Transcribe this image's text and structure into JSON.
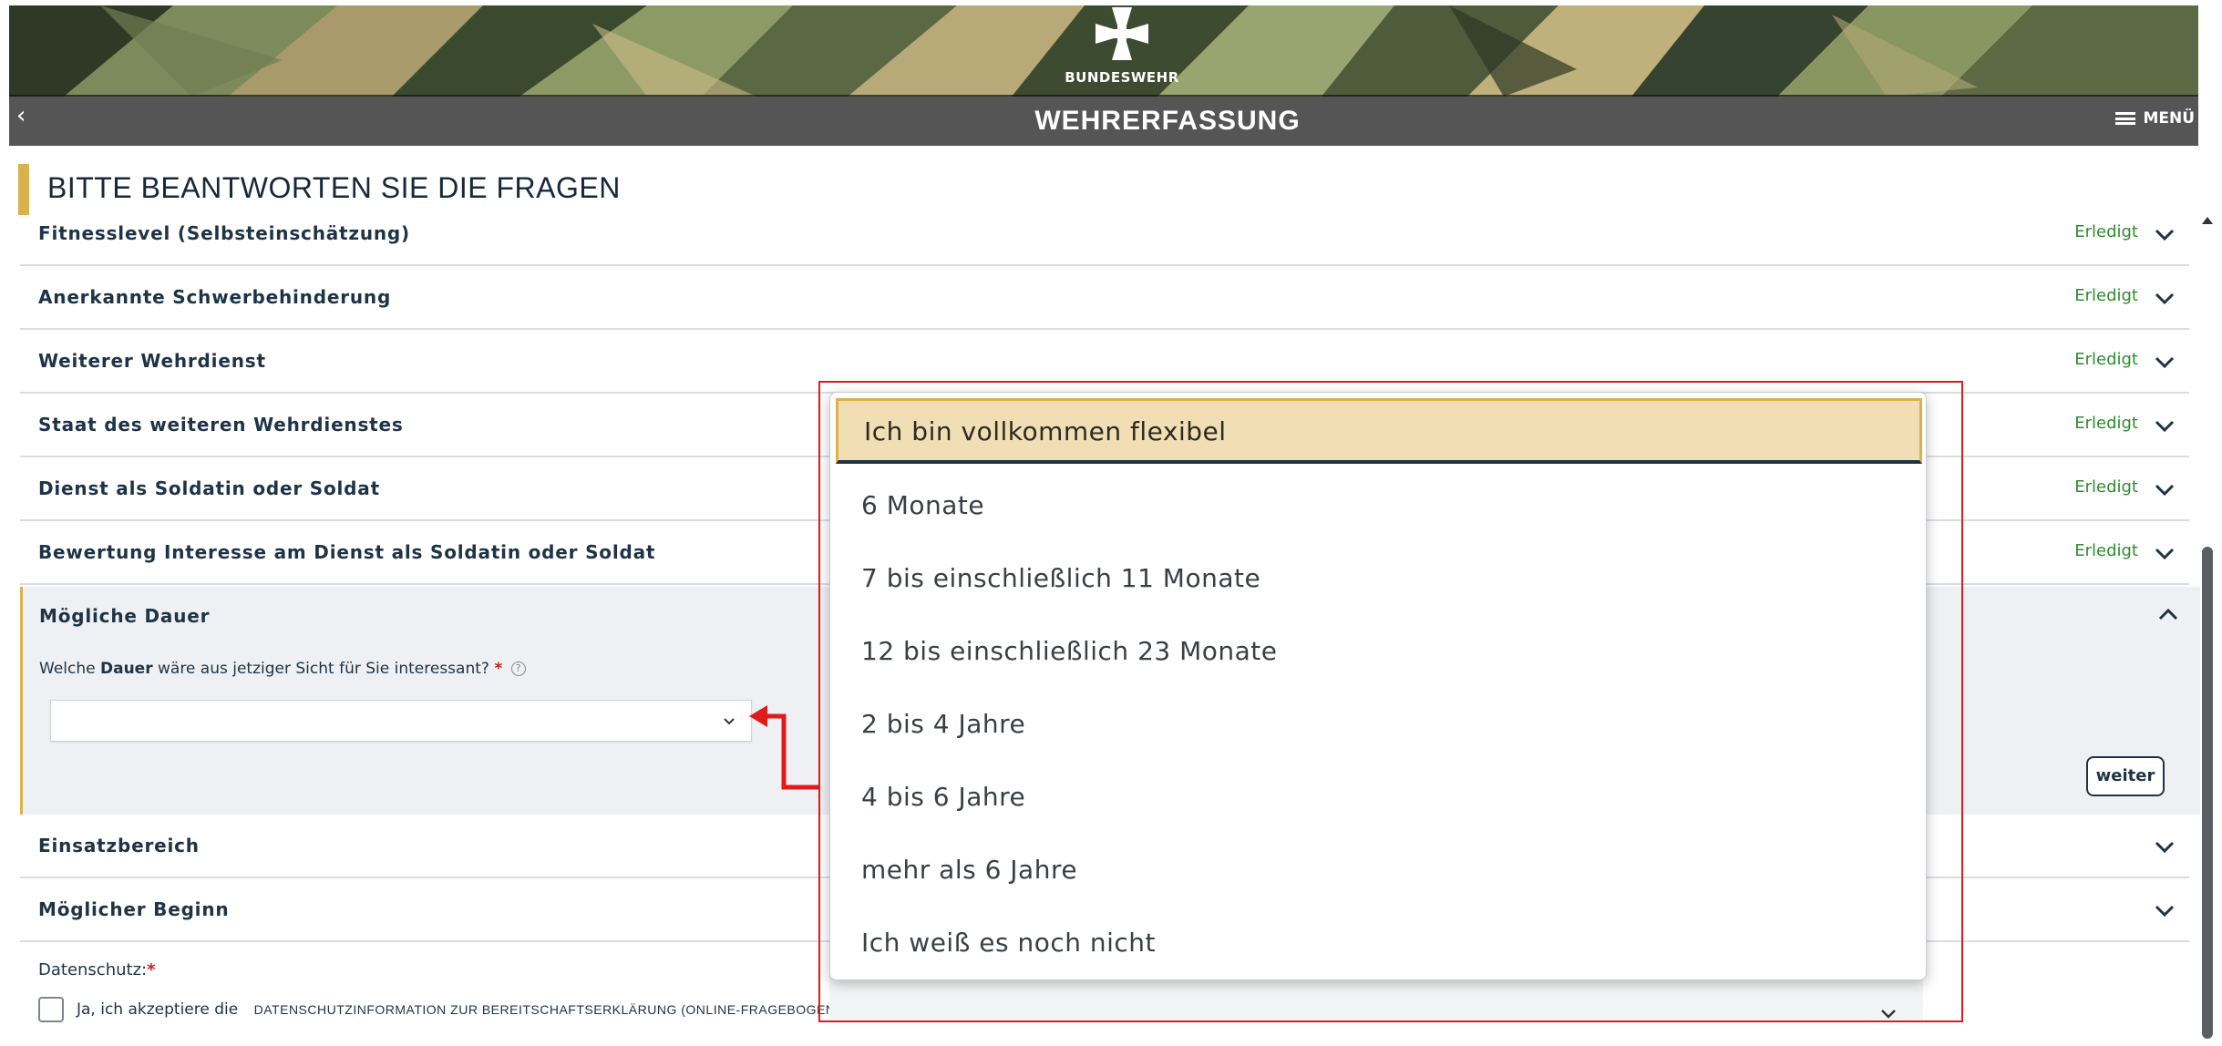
{
  "header": {
    "brand": "BUNDESWEHR",
    "title": "WEHRERFASSUNG",
    "back_icon": "chevron-left-icon",
    "menu_label": "MENÜ",
    "menu_icon": "hamburger-icon"
  },
  "page_heading": "BITTE BEANTWORTEN SIE DIE FRAGEN",
  "sections": [
    {
      "label": "Fitnesslevel (Selbsteinschätzung)",
      "status": "Erledigt"
    },
    {
      "label": "Anerkannte Schwerbehinderung",
      "status": "Erledigt"
    },
    {
      "label": "Weiterer Wehrdienst",
      "status": "Erledigt"
    },
    {
      "label": "Staat des weiteren Wehrdienstes",
      "status": "Erledigt"
    },
    {
      "label": "Dienst als Soldatin oder Soldat",
      "status": "Erledigt"
    },
    {
      "label": "Bewertung Interesse am Dienst als Soldatin oder Soldat",
      "status": "Erledigt"
    }
  ],
  "expanded_section": {
    "label": "Mögliche Dauer",
    "question_pre": "Welche ",
    "question_bold": "Dauer",
    "question_post": " wäre aus jetziger Sicht für Sie interessant?",
    "required_mark": "*",
    "help_icon": "?",
    "select_value": "",
    "next_button": "weiter"
  },
  "collapsed_sections": [
    {
      "label": "Einsatzbereich"
    },
    {
      "label": "Möglicher Beginn"
    }
  ],
  "privacy": {
    "label": "Datenschutz:",
    "required_mark": "*",
    "accept_text": "Ja, ich akzeptiere die",
    "link_text": "DATENSCHUTZINFORMATION ZUR BEREITSCHAFTSERKLÄRUNG (ONLINE-FRAGEBOGEN)"
  },
  "dropdown": {
    "options": [
      "Ich bin vollkommen flexibel",
      "6 Monate",
      "7 bis einschließlich 11 Monate",
      "12 bis einschließlich 23 Monate",
      "2 bis 4 Jahre",
      "4 bis 6 Jahre",
      "mehr als 6 Jahre",
      "Ich weiß es noch nicht"
    ],
    "selected_index": 0
  },
  "colors": {
    "accent": "#d9b24e",
    "done": "#2f8c2f",
    "annotation": "#e01b1b",
    "selected_bg": "#f1deb4"
  }
}
